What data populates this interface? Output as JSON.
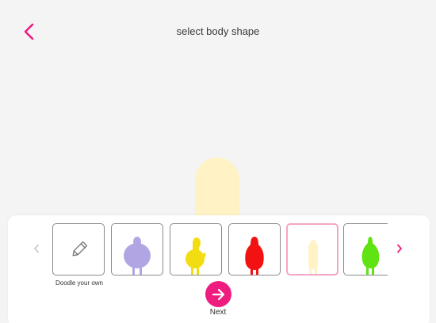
{
  "header": {
    "title": "select body shape",
    "back_icon": "chevron-left-icon",
    "accent_color": "#ef1c7f"
  },
  "preview": {
    "body_color": "#fff2c4"
  },
  "carousel": {
    "prev_icon": "chevron-left-icon",
    "next_icon": "chevron-right-icon",
    "doodle_label": "Doodle your own",
    "doodle_icon": "pencil-icon",
    "shapes": [
      {
        "name": "round",
        "color": "#b1a6e3"
      },
      {
        "name": "duck",
        "color": "#f2dd12"
      },
      {
        "name": "pear",
        "color": "#f21212"
      },
      {
        "name": "slim",
        "color": "#fff2c4",
        "selected": true
      },
      {
        "name": "egg",
        "color": "#5fe313"
      }
    ]
  },
  "footer": {
    "next_label": "Next",
    "next_icon": "arrow-right-icon"
  }
}
